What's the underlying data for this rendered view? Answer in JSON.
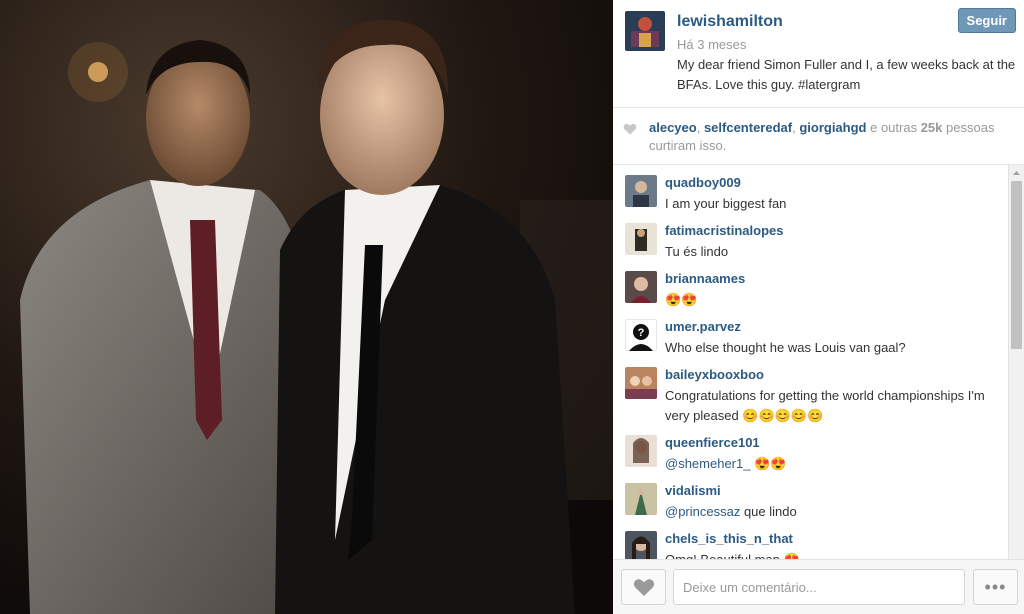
{
  "post": {
    "username": "lewishamilton",
    "time": "Há 3 meses",
    "caption": "My dear friend Simon Fuller and I, a few weeks back at the BFAs. Love this guy. #latergram",
    "follow_label": "Seguir"
  },
  "likes": {
    "user1": "alecyeo",
    "sep1": ", ",
    "user2": "selfcenteredaf",
    "sep2": ", ",
    "user3": "giorgiahgd",
    "mid": " e outras ",
    "count": "25k",
    "tail": " pessoas curtiram isso."
  },
  "comments": [
    {
      "user": "quadboy009",
      "text": "I am your biggest fan"
    },
    {
      "user": "fatimacristinalopes",
      "text": "Tu és lindo"
    },
    {
      "user": "briannaames",
      "text": "😍😍"
    },
    {
      "user": "umer.parvez",
      "text": "Who else thought he was Louis van gaal?"
    },
    {
      "user": "baileyxbooxboo",
      "text": "Congratulations for getting the world championships I'm very pleased 😊😊😊😊😊"
    },
    {
      "user": "queenfierce101",
      "mention": "@shemeher1_",
      "text": " 😍😍"
    },
    {
      "user": "vidalismi",
      "mention": "@princessaz",
      "text": " que lindo"
    },
    {
      "user": "chels_is_this_n_that",
      "text": "Omg! Beautiful man 😍"
    }
  ],
  "footer": {
    "comment_placeholder": "Deixe um comentário...",
    "more_label": "•••"
  },
  "icons": {
    "heart": "heart-icon",
    "more": "more-options-icon"
  },
  "colors": {
    "username": "#2b5a83",
    "follow_bg": "#6f97b6"
  }
}
